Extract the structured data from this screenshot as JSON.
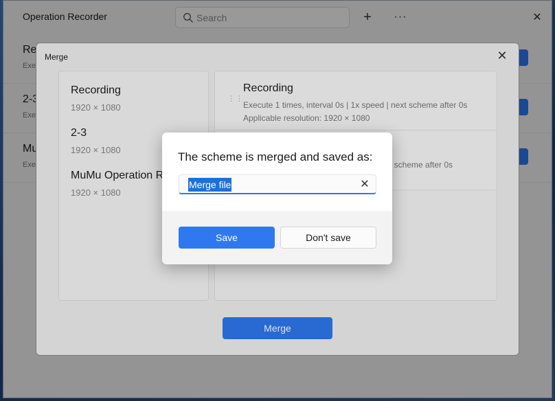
{
  "app": {
    "title": "Operation Recorder",
    "search_placeholder": "Search",
    "add_icon": "+",
    "more_icon": "···",
    "close_icon": "✕"
  },
  "list": [
    {
      "title": "Rec",
      "sub": "Exec"
    },
    {
      "title": "2-3",
      "sub": "Exec"
    },
    {
      "title": "Mu",
      "sub": "Exec"
    }
  ],
  "merge_dialog": {
    "title": "Merge",
    "close_icon": "✕",
    "left_items": [
      {
        "name": "Recording",
        "resolution": "1920 × 1080"
      },
      {
        "name": "2-3",
        "resolution": "1920 × 1080"
      },
      {
        "name": "MuMu Operation R",
        "resolution": "1920 × 1080"
      }
    ],
    "right_items": [
      {
        "name": "Recording",
        "desc": "Execute 1 times, interval 0s | 1x speed | next scheme after 0s",
        "resolution": "Applicable resolution: 1920 × 1080"
      },
      {
        "name": "",
        "desc": "xt scheme after 0s",
        "resolution": ""
      }
    ],
    "merge_button": "Merge"
  },
  "save_dialog": {
    "heading": "The scheme is merged and saved as:",
    "name_value": "Merge file",
    "clear_icon": "✕",
    "save_button": "Save",
    "dont_save_button": "Don't save"
  },
  "colors": {
    "accent": "#2f78f0",
    "selection": "#1e70d6"
  }
}
